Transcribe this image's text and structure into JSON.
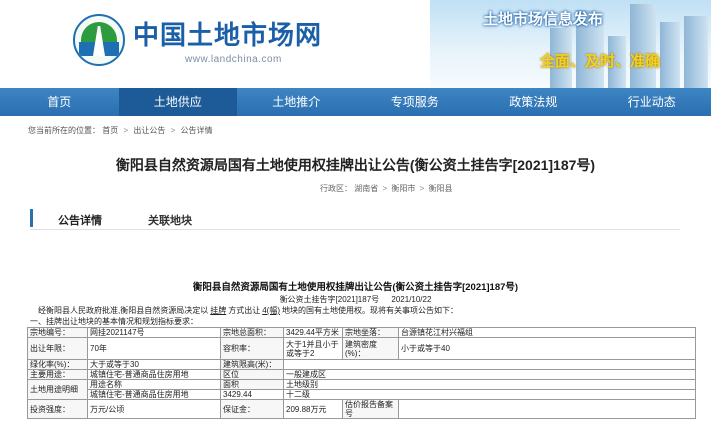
{
  "header": {
    "site_title": "中国土地市场网",
    "site_url": "www.landchina.com",
    "banner_title": "土地市场信息发布",
    "banner_slogan": "全面、及时、准确"
  },
  "nav": [
    "首页",
    "土地供应",
    "土地推介",
    "专项服务",
    "政策法规",
    "行业动态"
  ],
  "breadcrumb": {
    "prefix": "您当前所在的位置：",
    "items": [
      "首页",
      "出让公告",
      "公告详情"
    ]
  },
  "title": "衡阳县自然资源局国有土地使用权挂牌出让公告(衡公资土挂告字[2021]187号)",
  "region": {
    "label": "行政区：",
    "items": [
      "湖南省",
      "衡阳市",
      "衡阳县"
    ]
  },
  "tabs": [
    "公告详情",
    "关联地块"
  ],
  "notice": {
    "title": "衡阳县自然资源局国有土地使用权挂牌出让公告(衡公资土挂告字[2021]187号)",
    "doc_no": "衡公资土挂告字[2021]187号",
    "date": "2021/10/22",
    "para_1": "经衡阳县人民政府批准,衡阳县自然资源局决定以",
    "para_method": "挂牌",
    "para_2": "方式出让",
    "para_count": "4(幅)",
    "para_3": "地块的国有土地使用权。现将有关事项公告如下：",
    "section": "一、挂牌出让地块的基本情况和规划指标要求："
  },
  "table": {
    "r1": [
      "宗地编号：",
      "网挂2021147号",
      "宗地总面积：",
      "3429.44平方米",
      "宗地坐落：",
      "台源镇花江村兴福组"
    ],
    "r2": [
      "出让年限：",
      "70年",
      "容积率：",
      "大于1并且小于或等于2",
      "建筑密度(%)：",
      "小于或等于40"
    ],
    "r3": [
      "绿化率(%)：",
      "大于或等于30",
      "建筑限高(米)：",
      ""
    ],
    "r4": [
      "主要用途：",
      "城镇住宅-普通商品住房用地",
      "区位",
      "一般建成区"
    ],
    "r5": [
      "土地用途明细",
      "用途名称",
      "面积",
      "土地级别"
    ],
    "r6": [
      "城镇住宅-普通商品住房用地",
      "3429.44",
      "十二级"
    ],
    "r7": [
      "投资强度：",
      "万元/公顷",
      "保证金：",
      "209.88万元",
      "估价报告备案号",
      ""
    ]
  }
}
